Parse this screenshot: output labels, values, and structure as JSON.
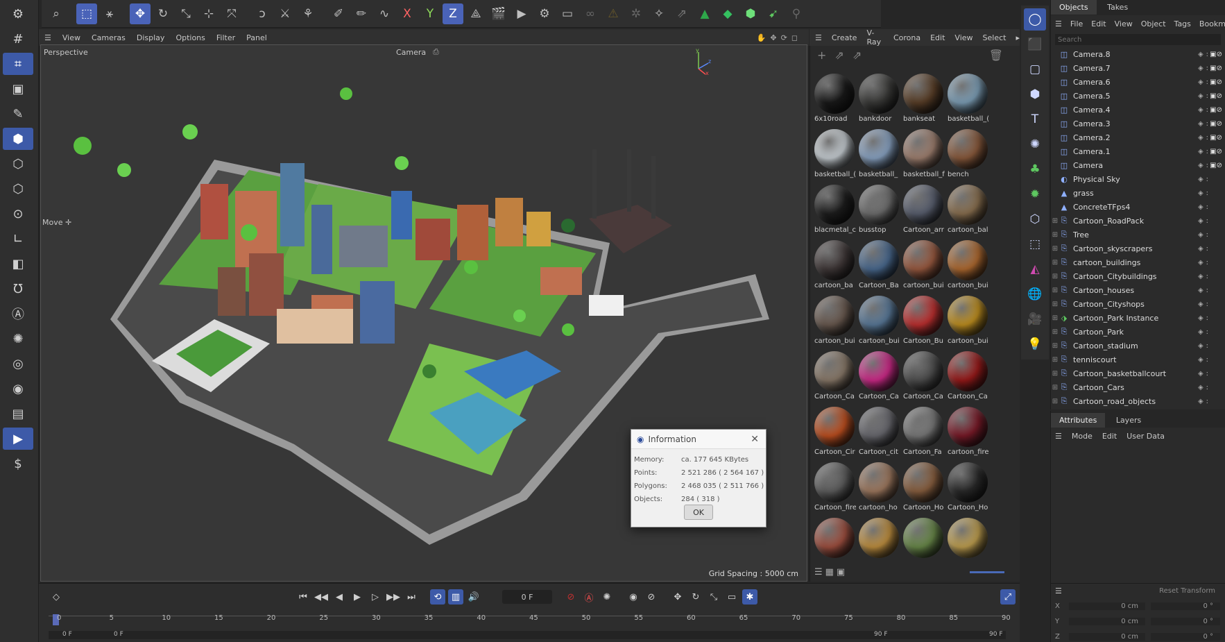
{
  "top_toolbar": {
    "icons": [
      "search-icon",
      "select-rect-icon",
      "live-select-icon",
      "move-icon",
      "rotate-icon",
      "scale-icon",
      "add-icon",
      "transform-icon",
      "spline-pen-icon",
      "knife-icon",
      "magnet-icon",
      "brush-icon",
      "paint-icon",
      "smooth-icon",
      "x-axis-icon",
      "y-axis-icon",
      "z-axis-icon",
      "coordinate-icon",
      "clapper-icon",
      "render-view-icon",
      "render-settings-icon",
      "render-queue-icon",
      "link-icon",
      "warning-icon",
      "gear-icon",
      "sparkle-icon",
      "export-icon",
      "corona-icon",
      "cube-green-icon",
      "cube-lightgreen-icon",
      "arrow-green-icon",
      "figure-icon"
    ]
  },
  "viewport": {
    "menu": [
      "View",
      "Cameras",
      "Display",
      "Options",
      "Filter",
      "Panel"
    ],
    "name": "Perspective",
    "camera": "Camera",
    "tool_label": "Move ✛",
    "grid_spacing": "Grid Spacing : 5000 cm"
  },
  "materials": {
    "menu": [
      "Create",
      "V-Ray",
      "Corona",
      "Edit",
      "View",
      "Select"
    ],
    "items": [
      {
        "label": "6x10road",
        "color": "#1a1a1a"
      },
      {
        "label": "bankdoor",
        "color": "#3a3a38"
      },
      {
        "label": "bankseat",
        "color": "#5a3f28"
      },
      {
        "label": "basketball_(",
        "color": "#7ea0b8"
      },
      {
        "label": "basketball_(",
        "color": "#c8cfd4"
      },
      {
        "label": "basketball_",
        "color": "#8aa4c4"
      },
      {
        "label": "basketball_f",
        "color": "#a08070"
      },
      {
        "label": "bench",
        "color": "#8a5a3c"
      },
      {
        "label": "blacmetal_c",
        "color": "#1e1e1e"
      },
      {
        "label": "busstop",
        "color": "#707070"
      },
      {
        "label": "Cartoon_arr",
        "color": "#5a6070"
      },
      {
        "label": "cartoon_bal",
        "color": "#8a7050"
      },
      {
        "label": "cartoon_ba",
        "color": "#403838"
      },
      {
        "label": "Cartoon_Ba",
        "color": "#4a6a90"
      },
      {
        "label": "cartoon_bui",
        "color": "#9a5a40"
      },
      {
        "label": "cartoon_bui",
        "color": "#b06a30"
      },
      {
        "label": "cartoon_bui",
        "color": "#6a5a50"
      },
      {
        "label": "cartoon_bui",
        "color": "#5a7a9a"
      },
      {
        "label": "Cartoon_Bu",
        "color": "#c03030"
      },
      {
        "label": "cartoon_bui",
        "color": "#c09020"
      },
      {
        "label": "Cartoon_Ca",
        "color": "#8a7a6a"
      },
      {
        "label": "Cartoon_Ca",
        "color": "#d02a8a"
      },
      {
        "label": "Cartoon_Ca",
        "color": "#505050"
      },
      {
        "label": "Cartoon_Ca",
        "color": "#9a1a1a"
      },
      {
        "label": "Cartoon_Cir",
        "color": "#c05020"
      },
      {
        "label": "Cartoon_cit",
        "color": "#6a6a70"
      },
      {
        "label": "Cartoon_Fa",
        "color": "#7a7a7a"
      },
      {
        "label": "cartoon_fire",
        "color": "#7a1a28"
      },
      {
        "label": "Cartoon_fire",
        "color": "#606060"
      },
      {
        "label": "cartoon_ho",
        "color": "#a07a60"
      },
      {
        "label": "Cartoon_Ho",
        "color": "#8a6040"
      },
      {
        "label": "Cartoon_Ho",
        "color": "#2a2a2a"
      },
      {
        "label": "",
        "color": "#a05040"
      },
      {
        "label": "",
        "color": "#c09040"
      },
      {
        "label": "",
        "color": "#6a8a4a"
      },
      {
        "label": "",
        "color": "#c0a050"
      }
    ]
  },
  "objects_panel": {
    "tabs": [
      "Objects",
      "Takes"
    ],
    "menu": [
      "File",
      "Edit",
      "View",
      "Object",
      "Tags",
      "Bookm"
    ],
    "search_placeholder": "Search",
    "rows": [
      {
        "name": "Camera.8",
        "type": "camera"
      },
      {
        "name": "Camera.7",
        "type": "camera"
      },
      {
        "name": "Camera.6",
        "type": "camera"
      },
      {
        "name": "Camera.5",
        "type": "camera"
      },
      {
        "name": "Camera.4",
        "type": "camera"
      },
      {
        "name": "Camera.3",
        "type": "camera"
      },
      {
        "name": "Camera.2",
        "type": "camera"
      },
      {
        "name": "Camera.1",
        "type": "camera"
      },
      {
        "name": "Camera",
        "type": "camera"
      },
      {
        "name": "Physical Sky",
        "type": "sky"
      },
      {
        "name": "grass",
        "type": "light"
      },
      {
        "name": "ConcreteTFps4",
        "type": "light"
      },
      {
        "name": "Cartoon_RoadPack",
        "type": "null"
      },
      {
        "name": "Tree",
        "type": "null"
      },
      {
        "name": "Cartoon_skyscrapers",
        "type": "null"
      },
      {
        "name": "cartoon_buildings",
        "type": "null"
      },
      {
        "name": "Cartoon_Citybuildings",
        "type": "null"
      },
      {
        "name": "Cartoon_houses",
        "type": "null"
      },
      {
        "name": "Cartoon_Cityshops",
        "type": "null"
      },
      {
        "name": "Cartoon_Park Instance",
        "type": "instance"
      },
      {
        "name": "Cartoon_Park",
        "type": "null"
      },
      {
        "name": "Cartoon_stadium",
        "type": "null"
      },
      {
        "name": "tenniscourt",
        "type": "null"
      },
      {
        "name": "Cartoon_basketballcourt",
        "type": "null"
      },
      {
        "name": "Cartoon_Cars",
        "type": "null"
      },
      {
        "name": "Cartoon_road_objects",
        "type": "null"
      }
    ]
  },
  "attributes_panel": {
    "tabs": [
      "Attributes",
      "Layers"
    ],
    "menu": [
      "Mode",
      "Edit",
      "User Data"
    ],
    "reset_label": "Reset Transform",
    "coords": [
      {
        "axis": "X",
        "pos": "0 cm",
        "rot": "0 °"
      },
      {
        "axis": "Y",
        "pos": "0 cm",
        "rot": "0 °"
      },
      {
        "axis": "Z",
        "pos": "0 cm",
        "rot": "0 °"
      }
    ]
  },
  "timeline": {
    "current_frame": "0 F",
    "ticks": [
      "0",
      "5",
      "10",
      "15",
      "20",
      "25",
      "30",
      "35",
      "40",
      "45",
      "50",
      "55",
      "60",
      "65",
      "70",
      "75",
      "80",
      "85",
      "90"
    ],
    "start": "0 F",
    "start2": "0 F",
    "end": "90 F",
    "end2": "90 F"
  },
  "info_dialog": {
    "title": "Information",
    "rows": [
      {
        "key": "Memory:",
        "value": "ca. 177 645 KBytes"
      },
      {
        "key": "Points:",
        "value": "2 521 286 ( 2 564 167 )"
      },
      {
        "key": "Polygons:",
        "value": "2 468 035 ( 2 511 766 )"
      },
      {
        "key": "Objects:",
        "value": "284 ( 318 )"
      }
    ],
    "ok_label": "OK"
  }
}
